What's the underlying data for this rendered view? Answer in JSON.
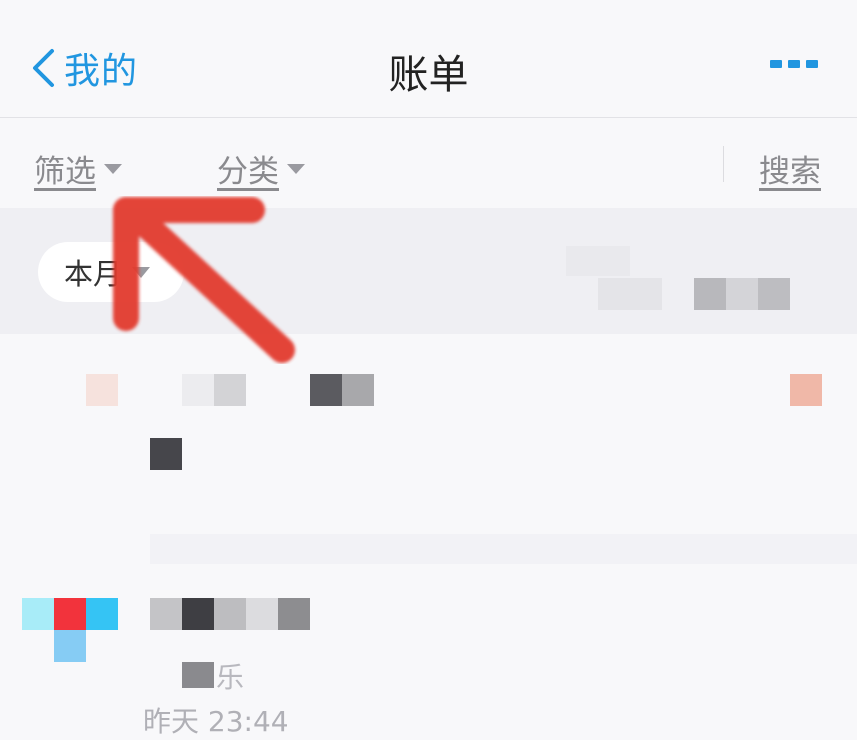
{
  "nav": {
    "back_label": "我的",
    "title": "账单",
    "more_icon": "more-dots-icon",
    "accent": "#2196e0"
  },
  "filters": {
    "filter_label": "筛选",
    "category_label": "分类",
    "search_label": "搜索"
  },
  "month": {
    "label": "本月"
  },
  "list": {
    "partial_text": "乐",
    "time": "昨天 23:44"
  },
  "annotation": {
    "arrow_color": "#e23a2e"
  }
}
